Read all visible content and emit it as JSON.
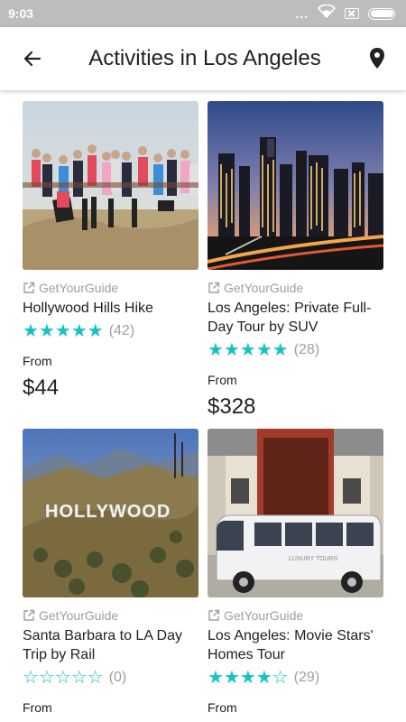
{
  "status_bar": {
    "time": "9:03",
    "dots": "..."
  },
  "header": {
    "title": "Activities in Los Angeles",
    "back_icon": "arrow-left-icon",
    "map_icon": "map-pin-icon"
  },
  "colors": {
    "star": "#16c2c5",
    "muted": "#9e9e9e",
    "status_bar": "#bdbdbd"
  },
  "cards": [
    {
      "provider": "GetYourGuide",
      "title": "Hollywood Hills Hike",
      "rating": 5,
      "reviews": "(42)",
      "from_label": "From",
      "price": "$44"
    },
    {
      "provider": "GetYourGuide",
      "title": "Los Angeles: Private Full-Day Tour by SUV",
      "rating": 5,
      "reviews": "(28)",
      "from_label": "From",
      "price": "$328"
    },
    {
      "provider": "GetYourGuide",
      "title": "Santa Barbara to LA Day Trip by Rail",
      "rating": 0,
      "reviews": "(0)",
      "from_label": "From",
      "price": ""
    },
    {
      "provider": "GetYourGuide",
      "title": "Los Angeles: Movie Stars' Homes Tour",
      "rating": 4,
      "reviews": "(29)",
      "from_label": "From",
      "price": ""
    }
  ],
  "image_text": {
    "hollywood_sign": "HOLLYWOOD",
    "van_decal": "LUXURY TOURS"
  }
}
